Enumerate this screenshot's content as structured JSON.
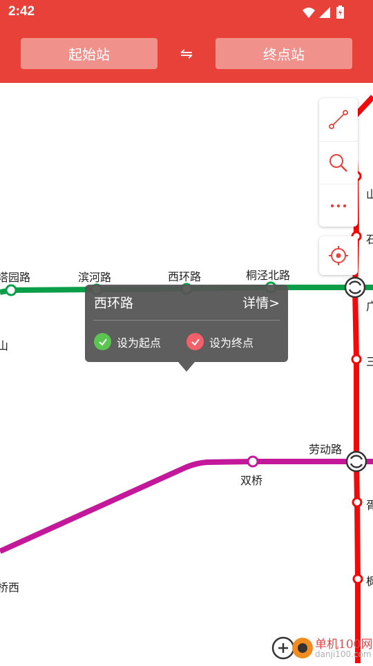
{
  "status_bar": {
    "time": "2:42"
  },
  "header": {
    "start_label": "起始站",
    "swap_icon": "⇋",
    "end_label": "终点站"
  },
  "map": {
    "stations": {
      "tayuan": "塔园路",
      "binhe": "滨河路",
      "xihuan": "西环路",
      "tongjing": "桐泾北路",
      "laodong": "劳动路",
      "shuangqiao": "双桥",
      "shan_left": "山",
      "qiaoxi": "桥西",
      "r1": "山",
      "r2": "石",
      "r3": "广",
      "r4": "三",
      "r5": "胥",
      "r6": "枫"
    },
    "colors": {
      "green_line": "#0a9e48",
      "red_line": "#f20a0a",
      "magenta_line": "#c4189a"
    }
  },
  "tools": {
    "items": [
      "route-icon",
      "search-icon",
      "more-icon",
      "locate-icon"
    ]
  },
  "popup": {
    "station": "西环路",
    "detail": "详情>",
    "set_start": "设为起点",
    "set_end": "设为终点"
  },
  "watermark": {
    "name": "单机100网",
    "url": "danji100.com"
  }
}
